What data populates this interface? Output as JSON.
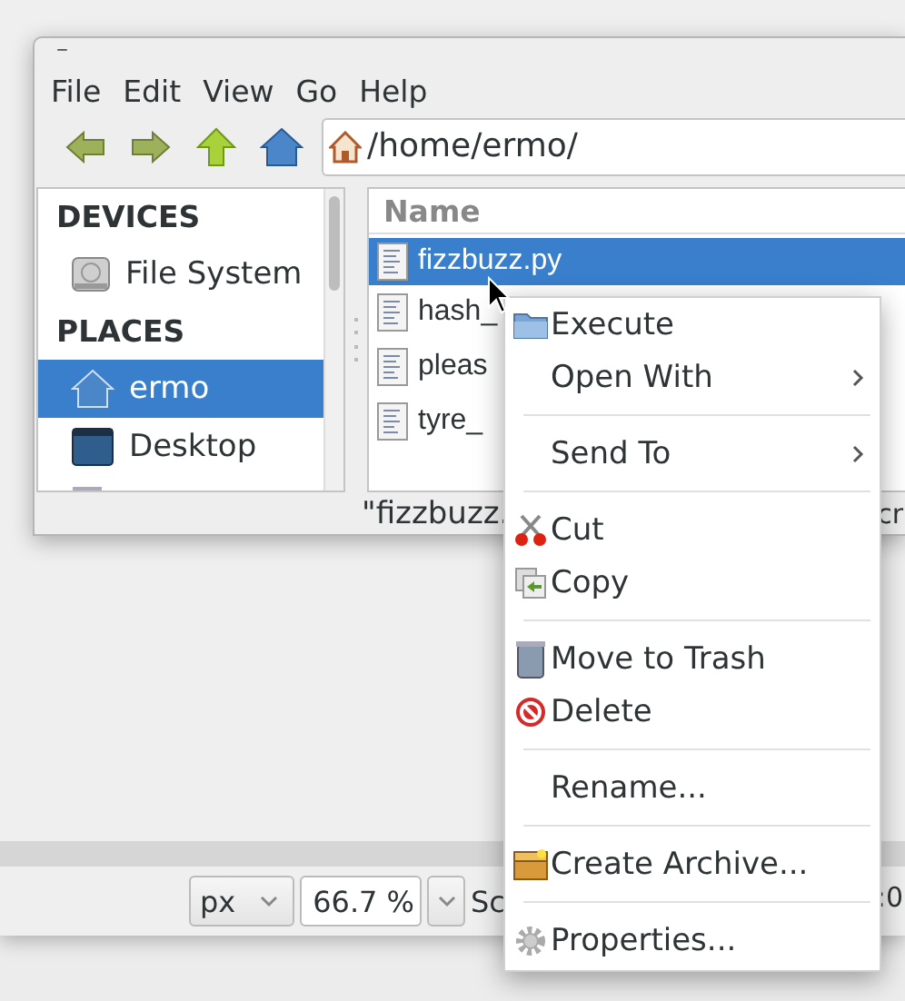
{
  "background_window": {
    "unit_select": "px",
    "zoom_field": "66.7 %",
    "status_text": "Sc",
    "status_tail": ":0"
  },
  "file_manager": {
    "title_bar": "–",
    "menu": [
      "File",
      "Edit",
      "View",
      "Go",
      "Help"
    ],
    "location": "/home/ermo/",
    "sidebar": [
      {
        "kind": "heading",
        "label": "DEVICES"
      },
      {
        "kind": "item",
        "label": "File System",
        "selected": false
      },
      {
        "kind": "heading",
        "label": "PLACES"
      },
      {
        "kind": "item",
        "label": "ermo",
        "selected": true
      },
      {
        "kind": "item",
        "label": "Desktop",
        "selected": false
      },
      {
        "kind": "item",
        "selected": false
      }
    ],
    "columns": [
      "Name"
    ],
    "files": [
      {
        "name": "fizzbuzz.py",
        "selected": true
      },
      {
        "name": "hash_",
        "selected": false
      },
      {
        "name": "pleas",
        "selected": false
      },
      {
        "name": "tyre_",
        "selected": false
      }
    ],
    "status_text": "\"fizzbuzz.",
    "status_tail": "cr"
  },
  "context_menu": [
    {
      "kind": "item",
      "label": "Execute",
      "submenu": false
    },
    {
      "kind": "item",
      "label": "Open With",
      "submenu": true
    },
    {
      "kind": "separator"
    },
    {
      "kind": "item",
      "label": "Send To",
      "submenu": true
    },
    {
      "kind": "separator"
    },
    {
      "kind": "item",
      "label": "Cut",
      "submenu": false
    },
    {
      "kind": "item",
      "label": "Copy",
      "submenu": false
    },
    {
      "kind": "separator"
    },
    {
      "kind": "item",
      "label": "Move to Trash",
      "submenu": false
    },
    {
      "kind": "item",
      "label": "Delete",
      "submenu": false
    },
    {
      "kind": "separator"
    },
    {
      "kind": "item",
      "label": "Rename...",
      "submenu": false
    },
    {
      "kind": "separator"
    },
    {
      "kind": "item",
      "label": "Create Archive...",
      "submenu": false
    },
    {
      "kind": "separator"
    },
    {
      "kind": "item",
      "label": "Properties...",
      "submenu": false
    }
  ]
}
